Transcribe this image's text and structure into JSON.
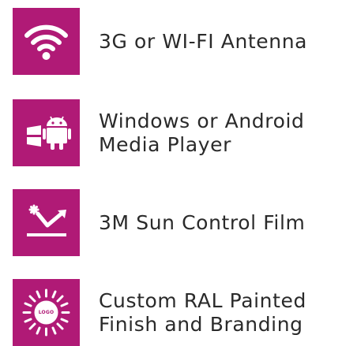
{
  "accent_color": "#b01a76",
  "features": [
    {
      "icon": "wifi-icon",
      "label": "3G or WI-FI Antenna"
    },
    {
      "icon": "windows-android-icon",
      "label": "Windows or Android\nMedia Player"
    },
    {
      "icon": "sun-control-film-icon",
      "label": "3M Sun Control Film"
    },
    {
      "icon": "logo-branding-icon",
      "label": "Custom RAL Painted\nFinish and Branding",
      "icon_text": "LOGO"
    }
  ]
}
